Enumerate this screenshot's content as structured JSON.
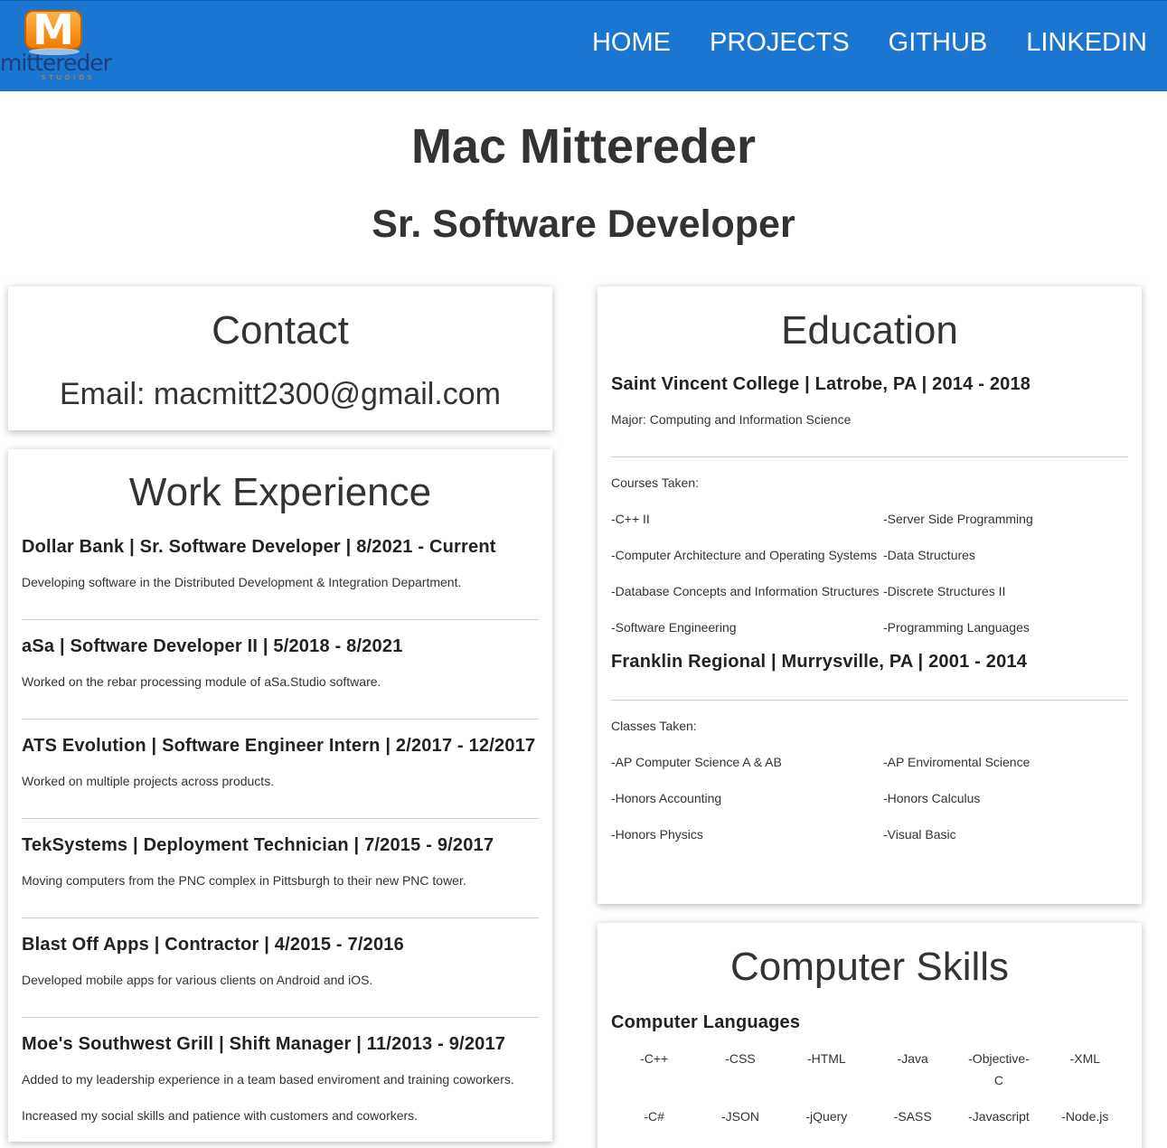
{
  "header": {
    "logo_letter": "M",
    "logo_word": "mittereder",
    "logo_sub": "STUDIOS",
    "nav": [
      "HOME",
      "PROJECTS",
      "GITHUB",
      "LINKEDIN"
    ],
    "bar_color": "#1b76d2"
  },
  "hero": {
    "name": "Mac Mittereder",
    "role": "Sr. Software Developer"
  },
  "contact": {
    "title": "Contact",
    "email": "Email: macmitt2300@gmail.com"
  },
  "work": {
    "title": "Work Experience",
    "jobs": [
      {
        "title": "Dollar Bank | Sr. Software Developer | 8/2021 - Current",
        "desc": [
          "Developing software in the Distributed Development & Integration Department."
        ]
      },
      {
        "title": "aSa | Software Developer II | 5/2018 - 8/2021",
        "desc": [
          "Worked on the rebar processing module of aSa.Studio software."
        ]
      },
      {
        "title": "ATS Evolution | Software Engineer Intern | 2/2017 - 12/2017",
        "desc": [
          "Worked on multiple projects across products."
        ]
      },
      {
        "title": "TekSystems | Deployment Technician | 7/2015 - 9/2017",
        "desc": [
          "Moving computers from the PNC complex in Pittsburgh to their new PNC tower."
        ]
      },
      {
        "title": "Blast Off Apps | Contractor | 4/2015 - 7/2016",
        "desc": [
          "Developed mobile apps for various clients on Android and iOS."
        ]
      },
      {
        "title": "Moe's Southwest Grill | Shift Manager | 11/2013 - 9/2017",
        "desc": [
          "Added to my leadership experience in a team based enviroment and training coworkers.",
          "Increased my social skills and patience with customers and coworkers."
        ]
      }
    ]
  },
  "education": {
    "title": "Education",
    "college": "Saint Vincent College | Latrobe, PA | 2014 - 2018",
    "major": "Major: Computing and Information Science",
    "courses_label": "Courses Taken:",
    "courses": [
      "-C++ II",
      "-Server Side Programming",
      "-Computer Architecture and Operating Systems",
      "-Data Structures",
      "-Database Concepts and Information Structures",
      "-Discrete Structures II",
      "-Software Engineering",
      "-Programming Languages"
    ],
    "high_school": "Franklin Regional | Murrysville, PA | 2001 - 2014",
    "classes_label": "Classes Taken:",
    "classes": [
      "-AP Computer Science A & AB",
      "-AP Enviromental Science",
      "-Honors Accounting",
      "-Honors Calculus",
      "-Honors Physics",
      "-Visual Basic"
    ]
  },
  "skills": {
    "title": "Computer Skills",
    "languages_label": "Computer Languages",
    "languages": [
      "-C++",
      "-CSS",
      "-HTML",
      "-Java",
      "-Objective-C",
      "-XML",
      "-C#",
      "-JSON",
      "-jQuery",
      "-SASS",
      "-Javascript",
      "-Node.js"
    ]
  }
}
